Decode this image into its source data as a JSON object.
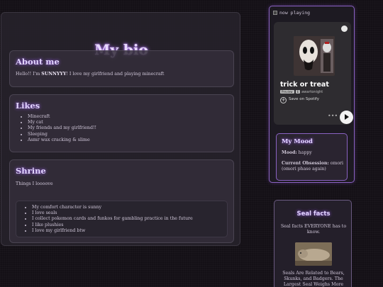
{
  "main": {
    "title": "My bio",
    "about": {
      "heading": "About me",
      "text_before": "Hello!! I'm ",
      "text_bold": "SUNNYYY",
      "text_after": "! I love my girlfriend and playing minecraft"
    },
    "likes": {
      "heading": "Likes",
      "items": [
        "Minecraft",
        "My cat",
        "My friends and my girlfriend!!",
        "Sleeping",
        "Asmr wax cracking & slime"
      ]
    },
    "shrine": {
      "heading": "Shrine",
      "intro": "Things I loooove",
      "items": [
        "My comfort character is sunny",
        "I love seals",
        "I collect pokemon cards and funkos for gambling practice in the future",
        "I like plushies",
        "I love my girlfriend btw"
      ]
    }
  },
  "sidebar": {
    "now_playing_label": "now playing",
    "spotify": {
      "track": "trick or treat",
      "badge_preview": "Preview",
      "badge_explicit": "E",
      "artist": "awartonight",
      "save_label": "Save on Spotify",
      "more": "•••"
    },
    "mood": {
      "heading": "My Mood",
      "mood_label": "Mood:",
      "mood_value": " happy",
      "obsession_label": "Current Obsession:",
      "obsession_value": " omori (omori phase again)"
    },
    "seal_facts": {
      "heading": "Seal facts",
      "intro": "Seal facts EVERYONE has to know.",
      "body": "Seals Are Related to Bears, Skunks, and Badgers. The Largest Seal Weighs More"
    }
  },
  "colors": {
    "accent": "#8a62c2",
    "glow": "#a060ff"
  }
}
